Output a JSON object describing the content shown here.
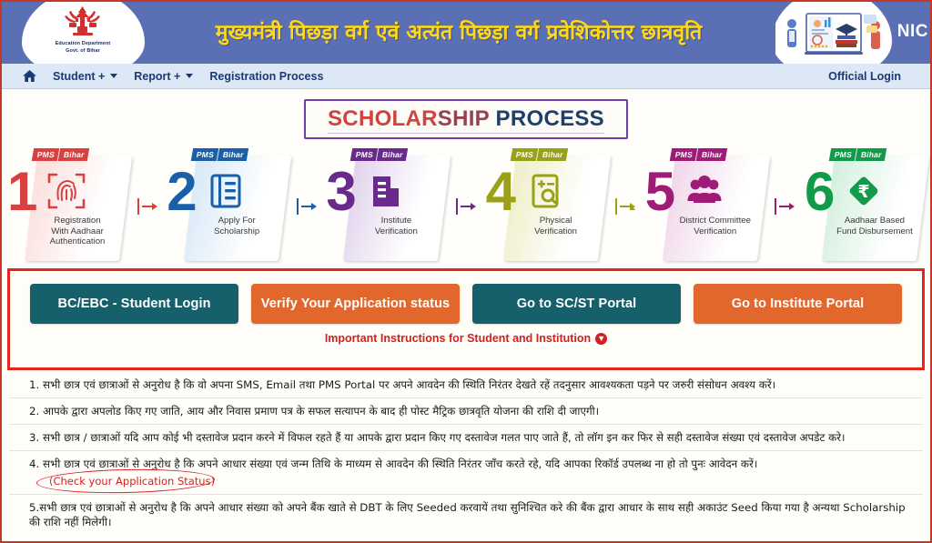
{
  "header": {
    "emblem_line1": "Education Department",
    "emblem_line2": "Govt. of Bihar",
    "title": "मुख्यमंत्री पिछड़ा वर्ग एवं अत्यंत पिछड़ा वर्ग प्रवेशिकोत्तर छात्रवृति",
    "nic_logo": "NIC"
  },
  "nav": {
    "home_icon": "home-icon",
    "items": [
      {
        "label": "Student +",
        "has_caret": true
      },
      {
        "label": "Report +",
        "has_caret": true
      },
      {
        "label": "Registration Process",
        "has_caret": false
      }
    ],
    "official_login": "Official Login"
  },
  "process": {
    "title_part1": "SCHOLAR",
    "title_part2": "SHIP",
    "title_part3": " PROCESS",
    "badge_left": "PMS",
    "badge_right": "Bihar",
    "steps": [
      {
        "number": "1",
        "label": "Registration\nWith Aadhaar\nAuthentication",
        "icon": "fingerprint-icon",
        "color": "#d9403f",
        "badge_dark": "#c0392b",
        "card_from": "#fbdedc",
        "card_to": "#ffffff"
      },
      {
        "number": "2",
        "label": "Apply For\nScholarship",
        "icon": "form-list-icon",
        "color": "#1a5fa8",
        "badge_dark": "#1a5fa8",
        "card_from": "#d7e8f7",
        "card_to": "#ffffff"
      },
      {
        "number": "3",
        "label": "Institute\nVerification",
        "icon": "building-icon",
        "color": "#6a2a8c",
        "badge_dark": "#6a2a8c",
        "card_from": "#e0d2ec",
        "card_to": "#ffffff"
      },
      {
        "number": "4",
        "label": "Physical\nVerification",
        "icon": "document-search-icon",
        "color": "#9aa017",
        "badge_dark": "#9aa017",
        "card_from": "#eeeec8",
        "card_to": "#ffffff"
      },
      {
        "number": "5",
        "label": "District Committee\nVerification",
        "icon": "people-group-icon",
        "color": "#a01a78",
        "badge_dark": "#a01a78",
        "card_from": "#f0d6e9",
        "card_to": "#ffffff"
      },
      {
        "number": "6",
        "label": "Aadhaar Based\nFund Disbursement",
        "icon": "rupee-diamond-icon",
        "color": "#119a4a",
        "badge_dark": "#119a4a",
        "card_from": "#d2efdc",
        "card_to": "#ffffff"
      }
    ],
    "separator_icon": "arrow-step-icon"
  },
  "actions": {
    "buttons": [
      {
        "label": "BC/EBC - Student Login",
        "style": "teal"
      },
      {
        "label": "Verify Your Application status",
        "style": "orange"
      },
      {
        "label": "Go to SC/ST Portal",
        "style": "teal"
      },
      {
        "label": "Go to Institute Portal",
        "style": "orange"
      }
    ],
    "instructions_heading": "Important Instructions for Student and Institution",
    "download_icon": "download-arrow-icon"
  },
  "instructions": {
    "rows": [
      "1. सभी छात्र एवं छात्राओं से अनुरोध है कि वो अपना SMS, Email तथा PMS Portal पर अपने आवदेन की स्थिति निरंतर देखते रहें तदनुसार आवश्यकता पड़ने पर जरुरी संसोधन अवश्य करें।",
      "2. आपके द्वारा अपलोड किए गए जाति, आय और निवास प्रमाण पत्र के सफल सत्यापन के बाद ही पोस्ट मैट्रिक छात्रवृति योजना की राशि दी जाएगी।",
      "3. सभी छात्र / छात्राओं यदि आप कोई भी दस्तावेज प्रदान करने में विफल रहते हैं या आपके द्वारा प्रदान किए गए दस्तावेज गलत पाए जाते हैं, तो लॉग इन कर फिर से सही दस्तावेज संख्या एवं दस्तावेज अपडेट करे।",
      "4. सभी छात्र एवं छात्राओं से अनुरोध है कि अपने आधार संख्या एवं जन्म तिथि के माध्यम से आवदेन की स्थिति निरंतर जाँच करते रहे, यदि आपका रिकॉर्ड उपलब्ध ना हो तो पुनः आवेदन करें।"
    ],
    "annotation_link": "(Check your Application Status)",
    "row5": "5.सभी छात्र एवं छात्राओं से अनुरोध है कि अपने आधार संख्या को अपने बैंक खाते से DBT के लिए Seeded करवायें तथा सुनिश्चित करे की बैंक द्वारा आधार के साथ सही अकाउंट Seed किया गया है अन्यथा Scholarship की राशि नहीं मिलेगी।"
  },
  "colors": {
    "header_bg": "#5b6fb5",
    "header_title": "#ffd915",
    "nav_bg": "#dde8f7",
    "nav_text": "#1b3a73",
    "alert_border": "#e5241c",
    "teal_button": "#16606c",
    "orange_button": "#e2672c",
    "annotation_red": "#d8252a"
  }
}
